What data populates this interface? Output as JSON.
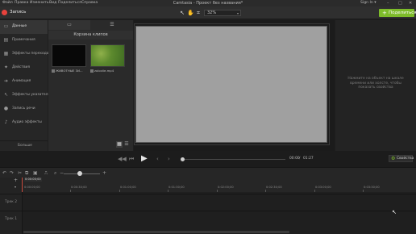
{
  "menu": [
    "Файл",
    "Правка",
    "Изменить",
    "Вид",
    "Поделиться",
    "Справка"
  ],
  "app_title": "Camtasia - Проект без названия*",
  "sign_in": "Sign In ▾",
  "window_controls": [
    "–",
    "□",
    "✕"
  ],
  "toolbar": {
    "record_label": "Запись",
    "zoom_value": "32%",
    "zoom_arrow": "▾",
    "share_label": "Поделиться",
    "share_plus": "+",
    "tools": [
      "arrow-pointer-icon",
      "hand-pan-icon",
      "crop-icon"
    ]
  },
  "sidebar": {
    "items": [
      {
        "label": "Данные",
        "icon": "media-icon",
        "glyph": "▭"
      },
      {
        "label": "Примечания",
        "icon": "annotation-icon",
        "glyph": "▤"
      },
      {
        "label": "Эффекты переходов",
        "icon": "transition-icon",
        "glyph": "▦"
      },
      {
        "label": "Действия",
        "icon": "behavior-icon",
        "glyph": "✦"
      },
      {
        "label": "Анимация",
        "icon": "animation-icon",
        "glyph": "➔"
      },
      {
        "label": "Эффекты указателя",
        "icon": "cursor-effects-icon",
        "glyph": "↖"
      },
      {
        "label": "Запись речи",
        "icon": "microphone-icon",
        "glyph": "🎙"
      },
      {
        "label": "Аудио эффекты",
        "icon": "audio-effects-icon",
        "glyph": "♪"
      }
    ],
    "more_label": "Больше",
    "add_glyph": "+"
  },
  "bin": {
    "title": "Корзина клипов",
    "tab_glyphs": [
      "▭",
      "☰"
    ],
    "clips": [
      {
        "label": "ЖИВОТНЫЕ ЗИ...",
        "thumb_color": "#080808"
      },
      {
        "label": "zoloviie.mp4",
        "thumb_color": "#5d8a2e"
      }
    ],
    "view_glyphs": [
      "▦",
      "☰"
    ]
  },
  "properties": {
    "hint": "Нажмите на объект на шкале времени или холсте, чтобы показать свойства",
    "button_label": "Свойства",
    "gear_glyph": "⚙"
  },
  "playback": {
    "glyphs": {
      "step_back": "◀◀",
      "back": "▶▎",
      "play": "▶",
      "prev": "‹",
      "next": "›"
    },
    "current_time": "00:00",
    "separator": "/",
    "total_time": "01:27"
  },
  "timeline_toolbar": {
    "glyphs": [
      "↶",
      "↷",
      "✂",
      "⧉",
      "▣"
    ],
    "zoom_minus": "−",
    "zoom_plus": "+",
    "zoom_icon": "🔍",
    "zoom_level": 0.4
  },
  "timeline": {
    "playhead_label": "0:00:00;00",
    "ticks": [
      "0:00:00;00",
      "0:00:30;00",
      "0:01:00;00",
      "0:01:30;00",
      "0:02:00;00",
      "0:02:30;00",
      "0:03:00;00",
      "0:03:30;00"
    ],
    "tracks": [
      "Трек 2",
      "Трек 1"
    ],
    "add_track": "+",
    "collapse": "▾"
  },
  "colors": {
    "accent_green": "#7dbb2a",
    "record_red": "#e8423c",
    "playhead": "#c94a3c"
  }
}
